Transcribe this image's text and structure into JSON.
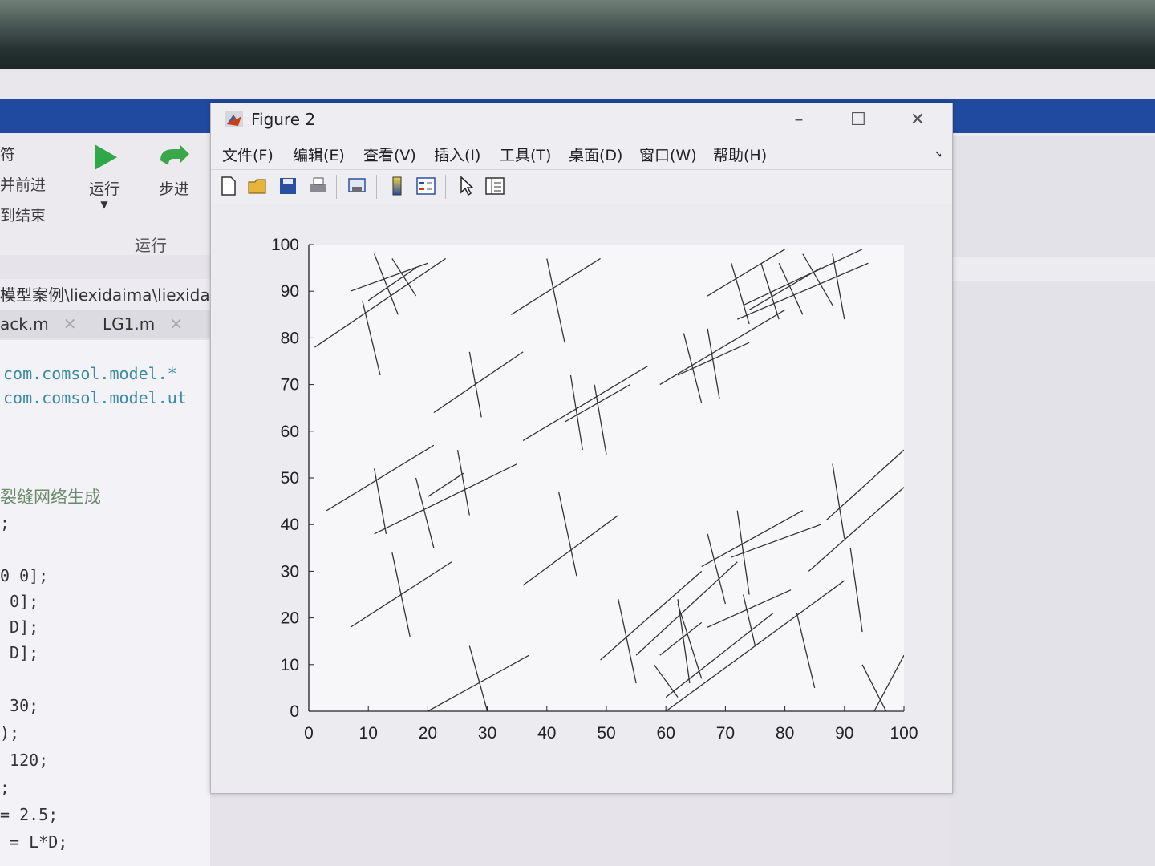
{
  "matlab": {
    "ribbon": {
      "left_labels": [
        "符",
        "并前进",
        "到结束"
      ],
      "run_label": "运行",
      "step_label": "步进",
      "section_label": "运行"
    },
    "path": "模型案例\\liexidaima\\liexida",
    "tabs": [
      {
        "label": "ack.m"
      },
      {
        "label": "LG1.m"
      }
    ],
    "code_lines": [
      "com.comsol.model.*",
      "com.comsol.model.ut",
      "裂缝网络生成",
      ";",
      "0 0];",
      " 0];",
      " D];",
      " D];",
      " 30;",
      ");",
      " 120;",
      ";",
      "= 2.5;",
      " = L*D;"
    ]
  },
  "figure": {
    "title": "Figure 2",
    "window_buttons": {
      "minimize": "–",
      "maximize": "☐",
      "close": "✕"
    },
    "menu": [
      "文件(F)",
      "编辑(E)",
      "查看(V)",
      "插入(I)",
      "工具(T)",
      "桌面(D)",
      "窗口(W)",
      "帮助(H)"
    ],
    "toolbar_icons": [
      "new-file-icon",
      "open-folder-icon",
      "save-icon",
      "print-icon",
      "print-preview-icon",
      "colorbar-icon",
      "legend-icon",
      "pointer-icon",
      "property-editor-icon"
    ]
  },
  "chart_data": {
    "type": "line",
    "title": "",
    "xlabel": "",
    "ylabel": "",
    "xlim": [
      0,
      100
    ],
    "ylim": [
      0,
      100
    ],
    "xticks": [
      0,
      10,
      20,
      30,
      40,
      50,
      60,
      70,
      80,
      90,
      100
    ],
    "yticks": [
      0,
      10,
      20,
      30,
      40,
      50,
      60,
      70,
      80,
      90,
      100
    ],
    "grid": false,
    "line_color": "#333333",
    "segments": [
      [
        [
          1,
          78
        ],
        [
          23,
          97
        ]
      ],
      [
        [
          10,
          88
        ],
        [
          18,
          95
        ]
      ],
      [
        [
          7,
          90
        ],
        [
          20,
          96
        ]
      ],
      [
        [
          9,
          88
        ],
        [
          12,
          72
        ]
      ],
      [
        [
          11,
          98
        ],
        [
          15,
          85
        ]
      ],
      [
        [
          14,
          97
        ],
        [
          18,
          89
        ]
      ],
      [
        [
          34,
          85
        ],
        [
          49,
          97
        ]
      ],
      [
        [
          40,
          97
        ],
        [
          43,
          79
        ]
      ],
      [
        [
          67,
          89
        ],
        [
          80,
          99
        ]
      ],
      [
        [
          73,
          87
        ],
        [
          93,
          99
        ]
      ],
      [
        [
          72,
          84
        ],
        [
          94,
          96
        ]
      ],
      [
        [
          71,
          96
        ],
        [
          74,
          83
        ]
      ],
      [
        [
          76,
          96
        ],
        [
          79,
          84
        ]
      ],
      [
        [
          79,
          96
        ],
        [
          83,
          85
        ]
      ],
      [
        [
          88,
          98
        ],
        [
          90,
          84
        ]
      ],
      [
        [
          83,
          98
        ],
        [
          88,
          87
        ]
      ],
      [
        [
          74,
          86
        ],
        [
          86,
          95
        ]
      ],
      [
        [
          59,
          70
        ],
        [
          80,
          86
        ]
      ],
      [
        [
          63,
          81
        ],
        [
          66,
          66
        ]
      ],
      [
        [
          67,
          82
        ],
        [
          69,
          67
        ]
      ],
      [
        [
          62,
          72
        ],
        [
          74,
          79
        ]
      ],
      [
        [
          21,
          64
        ],
        [
          36,
          77
        ]
      ],
      [
        [
          27,
          77
        ],
        [
          29,
          63
        ]
      ],
      [
        [
          36,
          58
        ],
        [
          57,
          74
        ]
      ],
      [
        [
          44,
          72
        ],
        [
          46,
          56
        ]
      ],
      [
        [
          48,
          70
        ],
        [
          50,
          55
        ]
      ],
      [
        [
          43,
          62
        ],
        [
          54,
          70
        ]
      ],
      [
        [
          3,
          43
        ],
        [
          21,
          57
        ]
      ],
      [
        [
          11,
          52
        ],
        [
          13,
          38
        ]
      ],
      [
        [
          18,
          50
        ],
        [
          21,
          35
        ]
      ],
      [
        [
          11,
          38
        ],
        [
          35,
          53
        ]
      ],
      [
        [
          20,
          46
        ],
        [
          26,
          51
        ]
      ],
      [
        [
          25,
          56
        ],
        [
          27,
          42
        ]
      ],
      [
        [
          36,
          27
        ],
        [
          52,
          42
        ]
      ],
      [
        [
          42,
          47
        ],
        [
          45,
          29
        ]
      ],
      [
        [
          7,
          18
        ],
        [
          24,
          32
        ]
      ],
      [
        [
          14,
          34
        ],
        [
          17,
          16
        ]
      ],
      [
        [
          20,
          0
        ],
        [
          37,
          12
        ]
      ],
      [
        [
          27,
          14
        ],
        [
          30,
          0
        ]
      ],
      [
        [
          49,
          11
        ],
        [
          66,
          30
        ]
      ],
      [
        [
          52,
          24
        ],
        [
          55,
          6
        ]
      ],
      [
        [
          55,
          12
        ],
        [
          72,
          32
        ]
      ],
      [
        [
          58,
          10
        ],
        [
          62,
          3
        ]
      ],
      [
        [
          60,
          3
        ],
        [
          78,
          21
        ]
      ],
      [
        [
          62,
          24
        ],
        [
          64,
          6
        ]
      ],
      [
        [
          67,
          38
        ],
        [
          70,
          23
        ]
      ],
      [
        [
          66,
          31
        ],
        [
          83,
          43
        ]
      ],
      [
        [
          72,
          43
        ],
        [
          74,
          25
        ]
      ],
      [
        [
          60,
          0
        ],
        [
          90,
          28
        ]
      ],
      [
        [
          82,
          21
        ],
        [
          85,
          5
        ]
      ],
      [
        [
          91,
          35
        ],
        [
          93,
          17
        ]
      ],
      [
        [
          84,
          30
        ],
        [
          100,
          48
        ]
      ],
      [
        [
          88,
          53
        ],
        [
          90,
          37
        ]
      ],
      [
        [
          87,
          41
        ],
        [
          100,
          56
        ]
      ],
      [
        [
          95,
          0
        ],
        [
          100,
          12
        ]
      ],
      [
        [
          93,
          10
        ],
        [
          97,
          0
        ]
      ],
      [
        [
          67,
          18
        ],
        [
          81,
          26
        ]
      ],
      [
        [
          73,
          25
        ],
        [
          75,
          14
        ]
      ],
      [
        [
          62,
          23
        ],
        [
          66,
          7
        ]
      ],
      [
        [
          59,
          12
        ],
        [
          66,
          19
        ]
      ],
      [
        [
          71,
          33
        ],
        [
          86,
          40
        ]
      ]
    ]
  }
}
